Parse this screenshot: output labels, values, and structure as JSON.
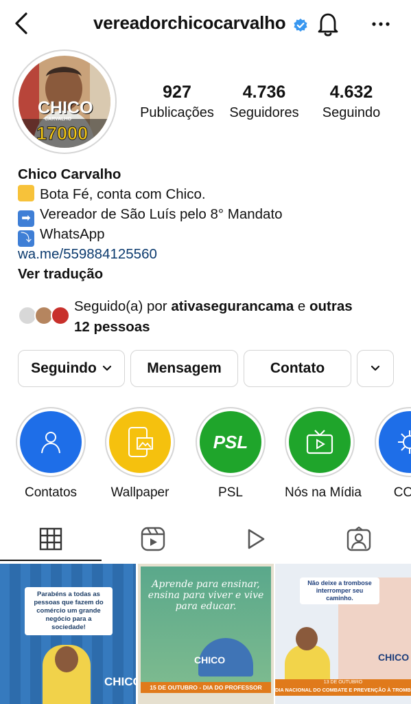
{
  "header": {
    "username": "vereadorchicocarvalho",
    "icons": [
      "back-arrow-icon",
      "verified-badge-icon",
      "bell-icon",
      "more-icon"
    ]
  },
  "avatar": {
    "logo_text": "CHICO",
    "logo_subtext": "CARVALHO",
    "number": "17000"
  },
  "stats": [
    {
      "value": "927",
      "label": "Publicações"
    },
    {
      "value": "4.736",
      "label": "Seguidores"
    },
    {
      "value": "4.632",
      "label": "Seguindo"
    }
  ],
  "bio": {
    "name": "Chico Carvalho",
    "line1": "Bota Fé, conta com Chico.",
    "line2": "Vereador de São Luís pelo 8° Mandato",
    "line3": "WhatsApp",
    "link": "wa.me/559884125560",
    "translate": "Ver tradução"
  },
  "followed_by": {
    "prefix": "Seguido(a) por ",
    "user": "ativasegurancama",
    "middle": " e ",
    "others": "outras",
    "count": "12 pessoas"
  },
  "buttons": {
    "following": "Seguindo",
    "message": "Mensagem",
    "contact": "Contato"
  },
  "highlights": [
    {
      "label": "Contatos",
      "color": "#1e6ee8"
    },
    {
      "label": "Wallpaper",
      "color": "#f5c10e"
    },
    {
      "label": "PSL",
      "color": "#1fa52b",
      "text": "PSL"
    },
    {
      "label": "Nós na Mídia",
      "color": "#1fa52b"
    },
    {
      "label": "COVI",
      "color": "#1e6ee8"
    }
  ],
  "tabs": [
    "grid-icon",
    "reels-icon",
    "video-play-icon",
    "tagged-icon"
  ],
  "posts": [
    {
      "text": "Parabéns a todas as pessoas que fazem do comércio um grande negócio para a sociedade!",
      "logo": "CHICO"
    },
    {
      "text": "Aprende para ensinar, ensina para viver e vive para educar.",
      "banner": "15 DE OUTUBRO - DIA DO PROFESSOR",
      "logo": "CHICO"
    },
    {
      "text": "Não deixe a trombose interromper seu caminho.",
      "banner_top": "13 DE OUTUBRO",
      "banner": "DIA NACIONAL DO COMBATE E PREVENÇÃO À TROMBOSE",
      "logo": "CHICO"
    }
  ]
}
